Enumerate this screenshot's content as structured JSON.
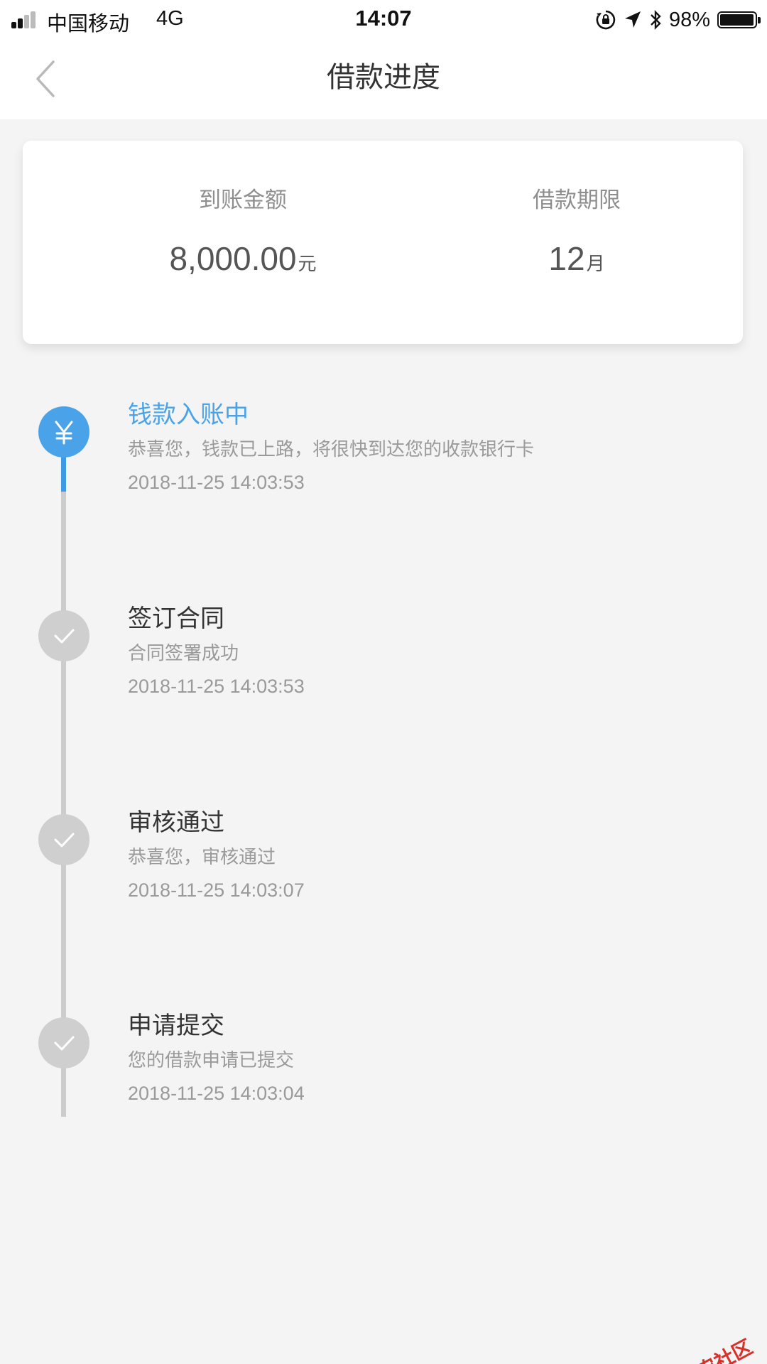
{
  "status_bar": {
    "carrier": "中国移动",
    "network": "4G",
    "time": "14:07",
    "battery_percent": "98%",
    "battery_level": 0.98,
    "icons": [
      "signal-icon",
      "orientation-lock-icon",
      "location-arrow-icon",
      "bluetooth-icon",
      "battery-icon"
    ]
  },
  "nav": {
    "title": "借款进度",
    "back_icon": "chevron-left-icon"
  },
  "summary": {
    "amount_label": "到账金额",
    "amount_value": "8,000.00",
    "amount_unit": "元",
    "term_label": "借款期限",
    "term_value": "12",
    "term_unit": "月"
  },
  "timeline": {
    "active_color": "#4aa3e8",
    "inactive_color": "#cfcfcf",
    "steps": [
      {
        "title": "钱款入账中",
        "desc": "恭喜您，钱款已上路，将很快到达您的收款银行卡",
        "time": "2018-11-25 14:03:53",
        "status": "active",
        "icon": "yuan-icon"
      },
      {
        "title": "签订合同",
        "desc": "合同签署成功",
        "time": "2018-11-25 14:03:53",
        "status": "done",
        "icon": "check-icon"
      },
      {
        "title": "审核通过",
        "desc": "恭喜您，审核通过",
        "time": "2018-11-25 14:03:07",
        "status": "done",
        "icon": "check-icon"
      },
      {
        "title": "申请提交",
        "desc": "您的借款申请已提交",
        "time": "2018-11-25 14:03:04",
        "status": "done",
        "icon": "check-icon"
      }
    ]
  },
  "watermark": {
    "text": "卡农社区",
    "icon": "kanong-logo-icon"
  }
}
